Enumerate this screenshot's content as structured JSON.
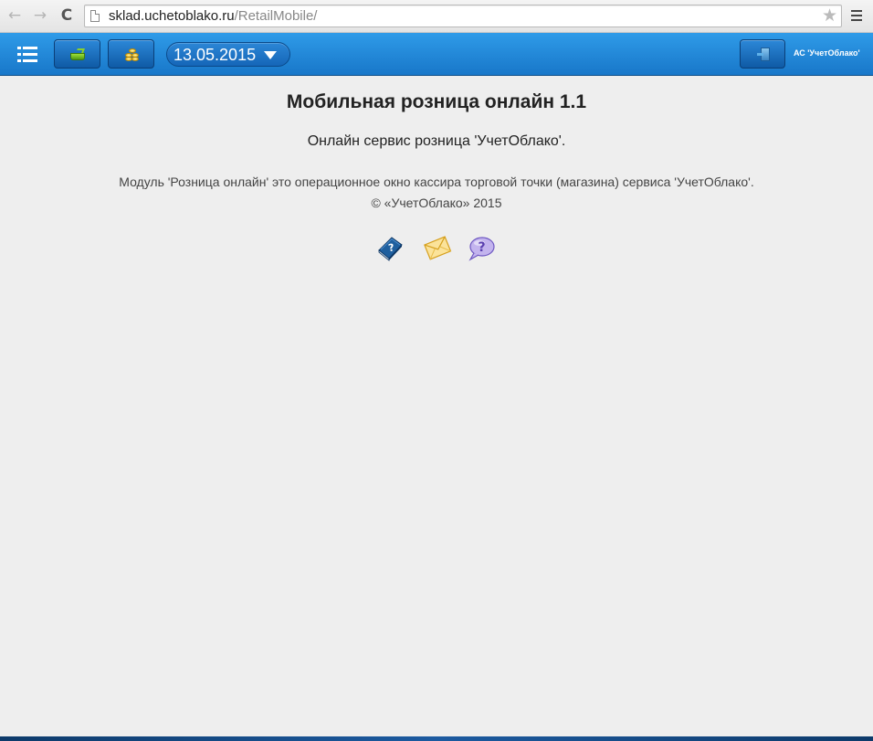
{
  "browser": {
    "url_host": "sklad.uchetoblako.ru",
    "url_path": "/RetailMobile/",
    "back_glyph": "←",
    "forward_glyph": "→",
    "reload_glyph": "C",
    "star_glyph": "★"
  },
  "toolbar": {
    "date": "13.05.2015",
    "org_label": "АС 'УчетОблако'"
  },
  "content": {
    "title": "Мобильная розница онлайн 1.1",
    "subtitle": "Онлайн сервис розница 'УчетОблако'.",
    "description": "Модуль 'Розница онлайн' это операционное окно кассира торговой точки (магазина) сервиса 'УчетОблако'.",
    "copyright": "© «УчетОблако» 2015"
  },
  "icons": {
    "menu": "list-icon",
    "basket": "basket-icon",
    "coins": "coins-icon",
    "dropdown": "chevron-down-icon",
    "exit": "exit-icon",
    "manual": "book-help-icon",
    "mail": "envelope-icon",
    "support": "speech-bubble-help-icon"
  },
  "colors": {
    "toolbar": "#1e88dc",
    "page_bg": "#eeeeee",
    "basket": "#8bd02c",
    "coins": "#e8b318"
  }
}
